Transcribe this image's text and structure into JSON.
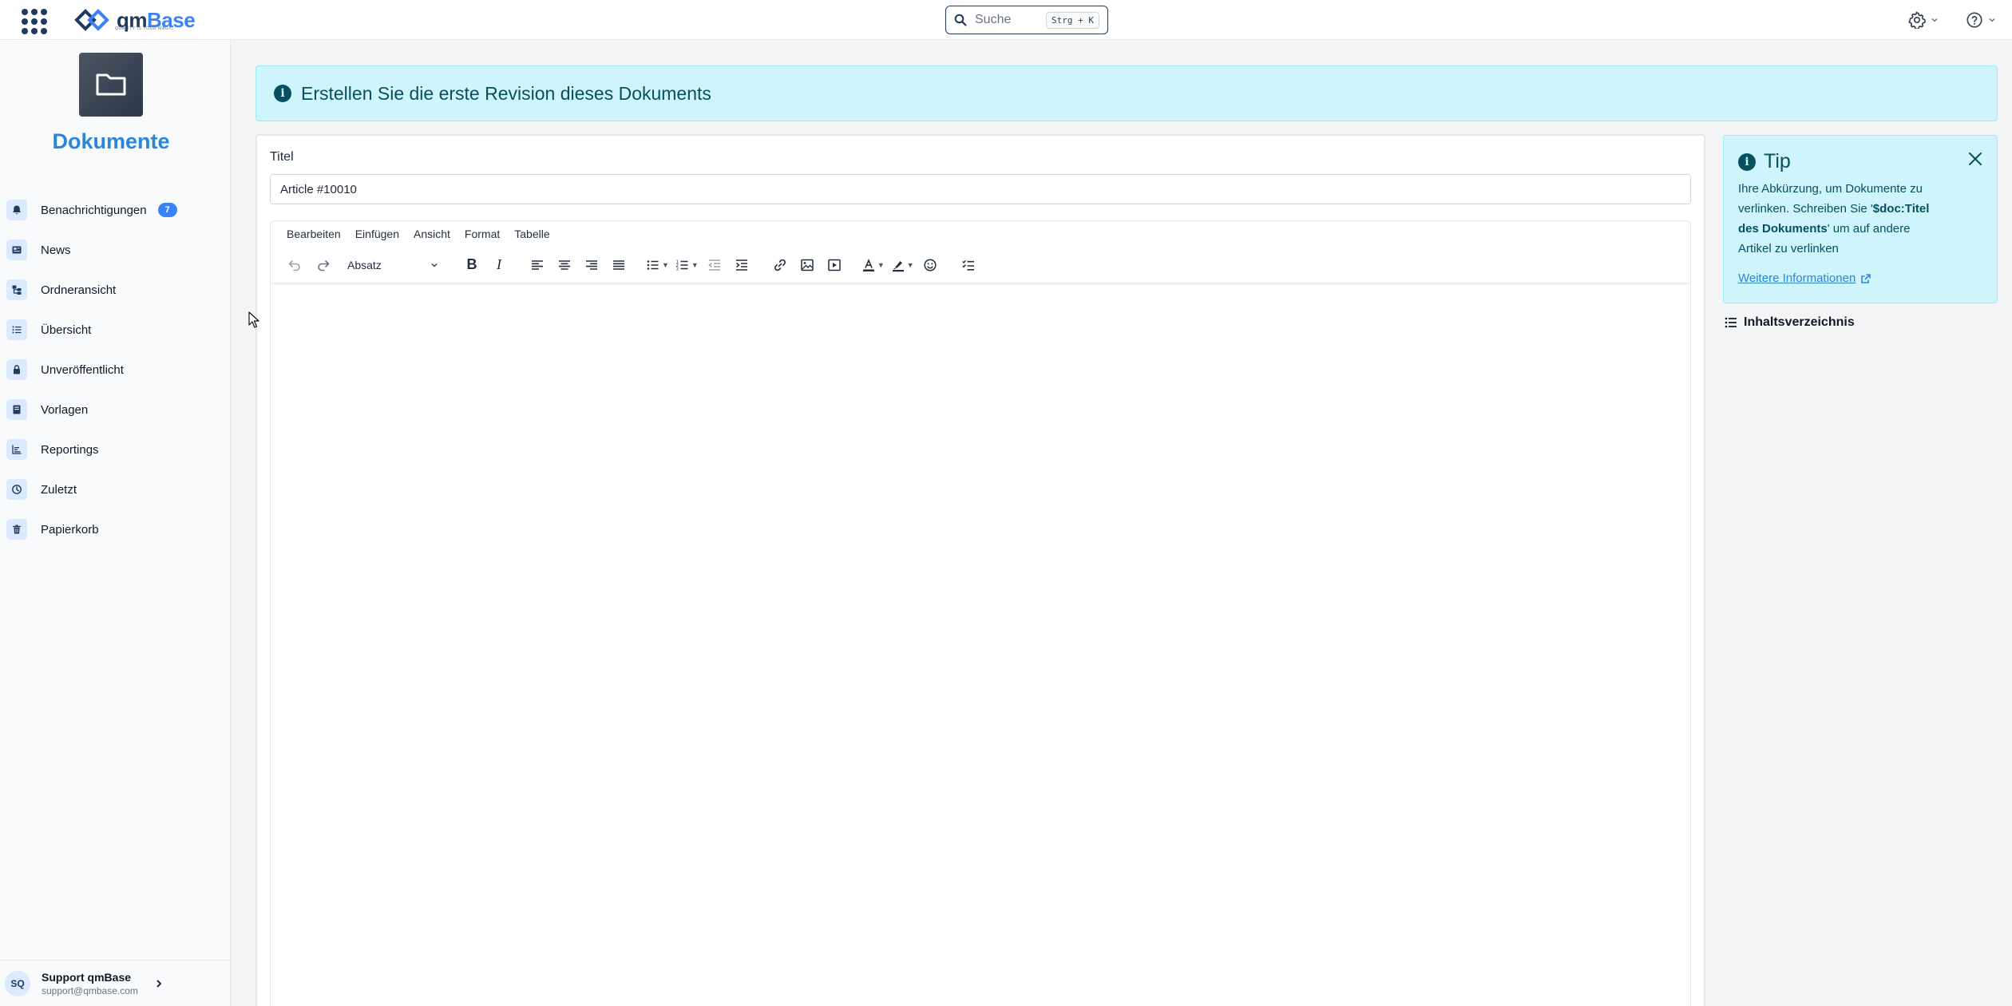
{
  "topbar": {
    "logo_main": "qm",
    "logo_accent": "Base",
    "logo_tagline": "QUALITY IS YOUR MAGIC",
    "search_placeholder": "Suche",
    "search_shortcut": "Strg + K"
  },
  "sidebar": {
    "title": "Dokumente",
    "items": [
      {
        "label": "Benachrichtigungen",
        "badge": "7",
        "icon": "bell-icon"
      },
      {
        "label": "News",
        "icon": "newspaper-icon"
      },
      {
        "label": "Ordneransicht",
        "icon": "folder-tree-icon"
      },
      {
        "label": "Übersicht",
        "icon": "list-icon"
      },
      {
        "label": "Unveröffentlicht",
        "icon": "lock-icon"
      },
      {
        "label": "Vorlagen",
        "icon": "book-icon"
      },
      {
        "label": "Reportings",
        "icon": "chart-icon"
      },
      {
        "label": "Zuletzt",
        "icon": "clock-icon"
      },
      {
        "label": "Papierkorb",
        "icon": "trash-icon"
      }
    ],
    "user": {
      "initials": "SQ",
      "name": "Support qmBase",
      "email": "support@qmbase.com"
    }
  },
  "banner": {
    "text": "Erstellen Sie die erste Revision dieses Dokuments"
  },
  "editor": {
    "title_label": "Titel",
    "title_value": "Article #10010",
    "menus": [
      "Bearbeiten",
      "Einfügen",
      "Ansicht",
      "Format",
      "Tabelle"
    ],
    "block_format": "Absatz"
  },
  "tip": {
    "title": "Tip",
    "body_1": "Ihre Abkürzung, um Dokumente zu verlinken. Schreiben Sie '",
    "body_code": "$doc:Titel des Dokuments",
    "body_2": "' um auf andere Artikel zu verlinken",
    "link": "Weitere Informationen"
  },
  "toc": {
    "label": "Inhaltsverzeichnis"
  },
  "colors": {
    "brand": "#1e3a5f",
    "accent": "#2b86d9",
    "info_bg": "#cff4fc",
    "info_text": "#055160"
  }
}
